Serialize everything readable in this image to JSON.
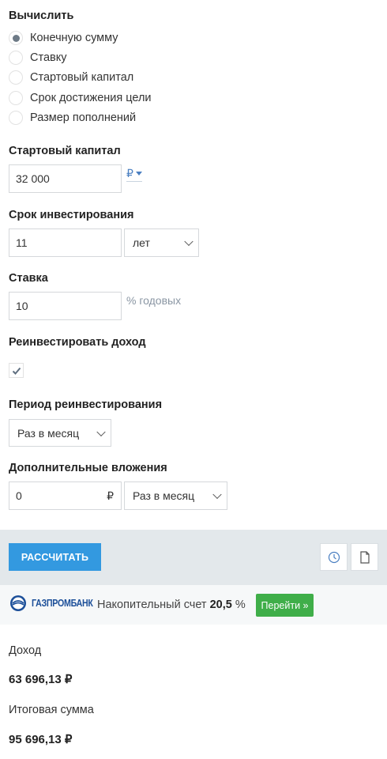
{
  "calculate": {
    "title": "Вычислить",
    "options": [
      {
        "label": "Конечную сумму",
        "checked": true
      },
      {
        "label": "Ставку",
        "checked": false
      },
      {
        "label": "Стартовый капитал",
        "checked": false
      },
      {
        "label": "Срок достижения цели",
        "checked": false
      },
      {
        "label": "Размер пополнений",
        "checked": false
      }
    ]
  },
  "start_capital": {
    "title": "Стартовый капитал",
    "value": "32 000",
    "currency": "₽"
  },
  "term": {
    "title": "Срок инвестирования",
    "value": "11",
    "unit": "лет"
  },
  "rate": {
    "title": "Ставка",
    "value": "10",
    "hint": "% годовых"
  },
  "reinvest": {
    "title": "Реинвестировать доход",
    "checked": true
  },
  "reinvest_period": {
    "title": "Период реинвестирования",
    "value": "Раз в месяц"
  },
  "additional": {
    "title": "Дополнительные вложения",
    "value": "0",
    "currency": "₽",
    "period": "Раз в месяц"
  },
  "actions": {
    "calculate_label": "РАССЧИТАТЬ",
    "history_icon": "clock-icon",
    "document_icon": "document-icon"
  },
  "ad": {
    "brand": "ГАЗПРОМБАНК",
    "text_prefix": "Накопительный счет",
    "rate": "20,5",
    "text_suffix": "%",
    "button_label": "Перейти »"
  },
  "results": {
    "income_label": "Доход",
    "income_value": "63 696,13 ₽",
    "total_label": "Итоговая сумма",
    "total_value": "95 696,13 ₽"
  },
  "colors": {
    "accent": "#3399e0",
    "ad_button": "#3fae49",
    "bar_bg": "#e3e8eb"
  }
}
